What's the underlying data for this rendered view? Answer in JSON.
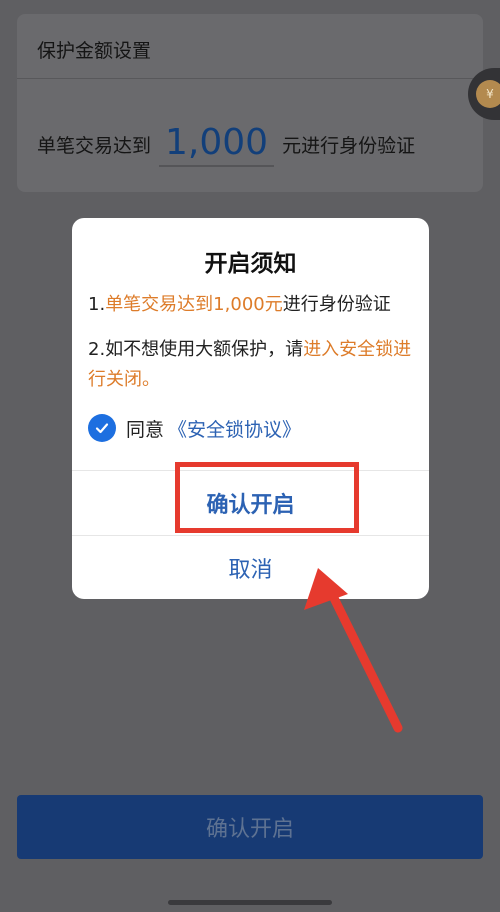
{
  "background_card": {
    "title": "保护金额设置",
    "amount_label_before": "单笔交易达到",
    "amount_value": "1,000",
    "amount_label_after": "元进行身份验证"
  },
  "bottom_button": {
    "label": "确认开启"
  },
  "dialog": {
    "title": "开启须知",
    "line1_prefix": "1.",
    "line1_highlight": "单笔交易达到1,000元",
    "line1_suffix": "进行身份验证",
    "line2_prefix": "2.如不想使用大额保护，请",
    "line2_highlight": "进入安全锁进行关闭。",
    "agree_label": "同意",
    "agreement_link": "《安全锁协议》",
    "confirm_label": "确认开启",
    "cancel_label": "取消"
  },
  "colors": {
    "accent_blue": "#2c62b3",
    "highlight_orange": "#dd7c2a",
    "annotation_red": "#e63a2e"
  },
  "icons": [
    "checkmark-icon",
    "side-float-coin-icon"
  ]
}
